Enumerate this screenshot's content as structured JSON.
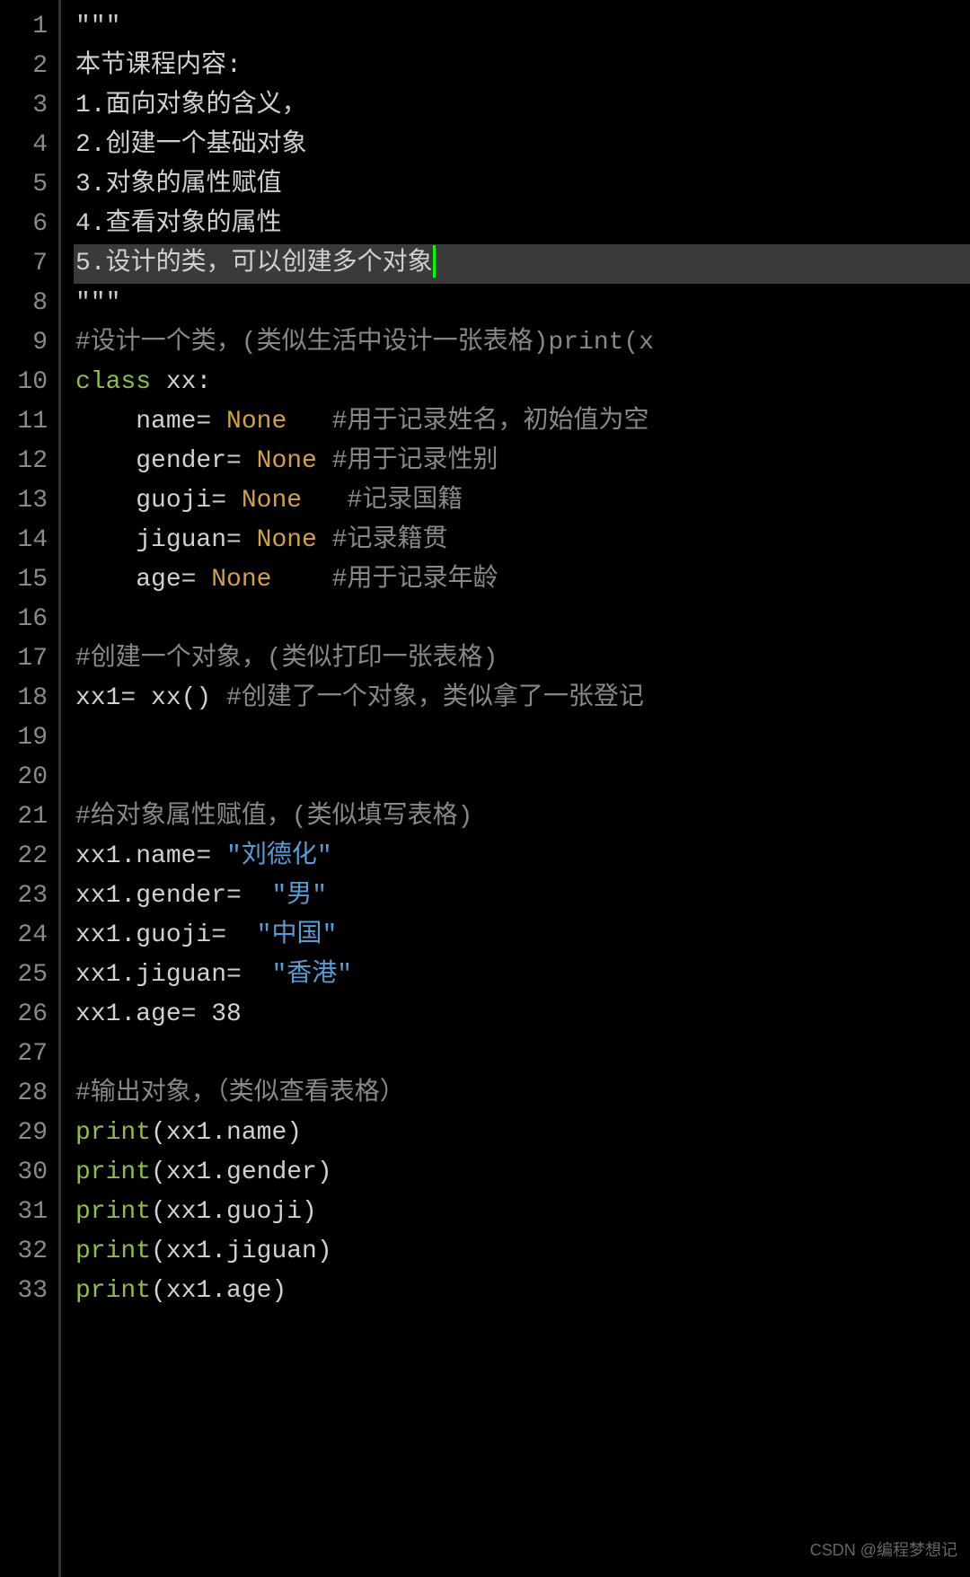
{
  "watermark": "CSDN @编程梦想记",
  "highlighted_line": 7,
  "lines": [
    {
      "n": 1,
      "tokens": [
        {
          "c": "tk-str",
          "t": "\"\"\""
        }
      ]
    },
    {
      "n": 2,
      "tokens": [
        {
          "c": "tk-id",
          "t": "本节课程内容:"
        }
      ]
    },
    {
      "n": 3,
      "tokens": [
        {
          "c": "tk-id",
          "t": "1.面向对象的含义，"
        }
      ]
    },
    {
      "n": 4,
      "tokens": [
        {
          "c": "tk-id",
          "t": "2.创建一个基础对象"
        }
      ]
    },
    {
      "n": 5,
      "tokens": [
        {
          "c": "tk-id",
          "t": "3.对象的属性赋值"
        }
      ]
    },
    {
      "n": 6,
      "tokens": [
        {
          "c": "tk-id",
          "t": "4.查看对象的属性"
        }
      ]
    },
    {
      "n": 7,
      "tokens": [
        {
          "c": "tk-id",
          "t": "5.设计的类，可以创建多个对象"
        }
      ],
      "cursor": true
    },
    {
      "n": 8,
      "tokens": [
        {
          "c": "tk-str",
          "t": "\"\"\""
        }
      ]
    },
    {
      "n": 9,
      "tokens": [
        {
          "c": "tk-cmt",
          "t": "#设计一个类，(类似生活中设计一张表格)print(x"
        }
      ]
    },
    {
      "n": 10,
      "tokens": [
        {
          "c": "tk-kw",
          "t": "class"
        },
        {
          "c": "tk-id",
          "t": " "
        },
        {
          "c": "tk-cls",
          "t": "xx"
        },
        {
          "c": "tk-id",
          "t": ":"
        }
      ]
    },
    {
      "n": 11,
      "tokens": [
        {
          "c": "tk-id",
          "t": "    name= "
        },
        {
          "c": "tk-none",
          "t": "None"
        },
        {
          "c": "tk-id",
          "t": "   "
        },
        {
          "c": "tk-cmt",
          "t": "#用于记录姓名，初始值为空"
        }
      ]
    },
    {
      "n": 12,
      "tokens": [
        {
          "c": "tk-id",
          "t": "    gender= "
        },
        {
          "c": "tk-none",
          "t": "None"
        },
        {
          "c": "tk-id",
          "t": " "
        },
        {
          "c": "tk-cmt",
          "t": "#用于记录性别"
        }
      ]
    },
    {
      "n": 13,
      "tokens": [
        {
          "c": "tk-id",
          "t": "    guoji= "
        },
        {
          "c": "tk-none",
          "t": "None"
        },
        {
          "c": "tk-id",
          "t": "   "
        },
        {
          "c": "tk-cmt",
          "t": "#记录国籍"
        }
      ]
    },
    {
      "n": 14,
      "tokens": [
        {
          "c": "tk-id",
          "t": "    jiguan= "
        },
        {
          "c": "tk-none",
          "t": "None"
        },
        {
          "c": "tk-id",
          "t": " "
        },
        {
          "c": "tk-cmt",
          "t": "#记录籍贯"
        }
      ]
    },
    {
      "n": 15,
      "tokens": [
        {
          "c": "tk-id",
          "t": "    age= "
        },
        {
          "c": "tk-none",
          "t": "None"
        },
        {
          "c": "tk-id",
          "t": "    "
        },
        {
          "c": "tk-cmt",
          "t": "#用于记录年龄"
        }
      ]
    },
    {
      "n": 16,
      "tokens": []
    },
    {
      "n": 17,
      "tokens": [
        {
          "c": "tk-cmt",
          "t": "#创建一个对象，(类似打印一张表格)"
        }
      ]
    },
    {
      "n": 18,
      "tokens": [
        {
          "c": "tk-id",
          "t": "xx1= xx() "
        },
        {
          "c": "tk-cmt",
          "t": "#创建了一个对象，类似拿了一张登记"
        }
      ]
    },
    {
      "n": 19,
      "tokens": []
    },
    {
      "n": 20,
      "tokens": []
    },
    {
      "n": 21,
      "tokens": [
        {
          "c": "tk-cmt",
          "t": "#给对象属性赋值，(类似填写表格)"
        }
      ]
    },
    {
      "n": 22,
      "tokens": [
        {
          "c": "tk-id",
          "t": "xx1.name= "
        },
        {
          "c": "tk-strlit",
          "t": "\"刘德化\""
        }
      ]
    },
    {
      "n": 23,
      "tokens": [
        {
          "c": "tk-id",
          "t": "xx1.gender=  "
        },
        {
          "c": "tk-strlit",
          "t": "\"男\""
        }
      ]
    },
    {
      "n": 24,
      "tokens": [
        {
          "c": "tk-id",
          "t": "xx1.guoji=  "
        },
        {
          "c": "tk-strlit",
          "t": "\"中国\""
        }
      ]
    },
    {
      "n": 25,
      "tokens": [
        {
          "c": "tk-id",
          "t": "xx1.jiguan=  "
        },
        {
          "c": "tk-strlit",
          "t": "\"香港\""
        }
      ]
    },
    {
      "n": 26,
      "tokens": [
        {
          "c": "tk-id",
          "t": "xx1.age= "
        },
        {
          "c": "tk-num",
          "t": "38"
        }
      ]
    },
    {
      "n": 27,
      "tokens": []
    },
    {
      "n": 28,
      "tokens": [
        {
          "c": "tk-cmt",
          "t": "#输出对象，（类似查看表格）"
        }
      ]
    },
    {
      "n": 29,
      "tokens": [
        {
          "c": "tk-fn",
          "t": "print"
        },
        {
          "c": "tk-id",
          "t": "(xx1.name)"
        }
      ]
    },
    {
      "n": 30,
      "tokens": [
        {
          "c": "tk-fn",
          "t": "print"
        },
        {
          "c": "tk-id",
          "t": "(xx1.gender)"
        }
      ]
    },
    {
      "n": 31,
      "tokens": [
        {
          "c": "tk-fn",
          "t": "print"
        },
        {
          "c": "tk-id",
          "t": "(xx1.guoji)"
        }
      ]
    },
    {
      "n": 32,
      "tokens": [
        {
          "c": "tk-fn",
          "t": "print"
        },
        {
          "c": "tk-id",
          "t": "(xx1.jiguan)"
        }
      ]
    },
    {
      "n": 33,
      "tokens": [
        {
          "c": "tk-fn",
          "t": "print"
        },
        {
          "c": "tk-id",
          "t": "(xx1.age)"
        }
      ]
    }
  ]
}
